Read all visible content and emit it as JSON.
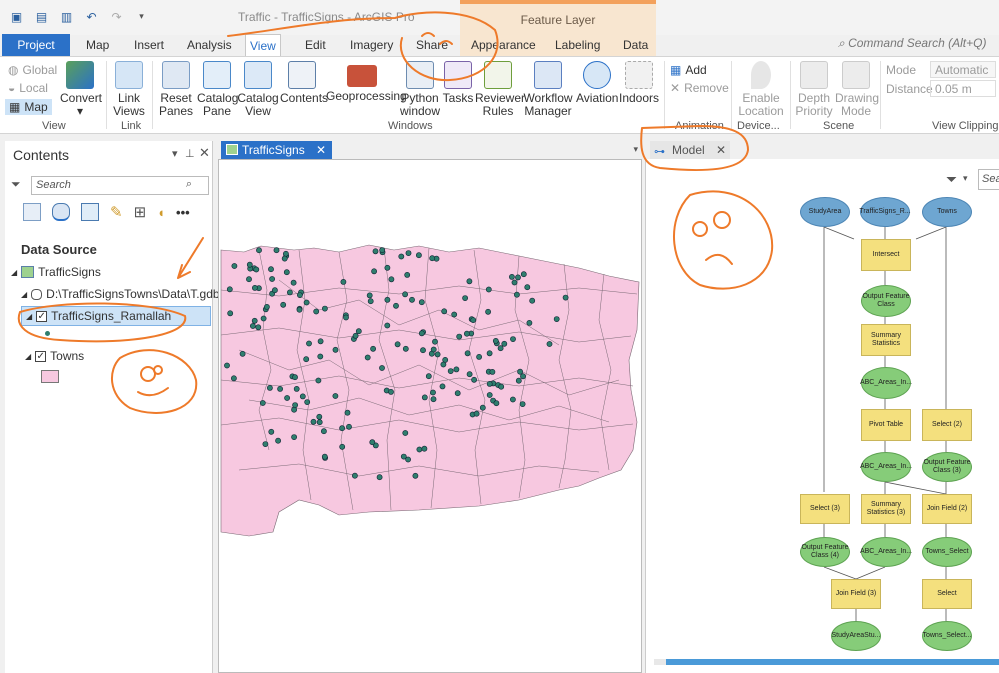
{
  "app": {
    "title": "Traffic - TrafficSigns - ArcGIS Pro",
    "context_tab_header": "Feature Layer"
  },
  "ribbon_tabs": [
    "Project",
    "Map",
    "Insert",
    "Analysis",
    "View",
    "Edit",
    "Imagery",
    "Share",
    "Appearance",
    "Labeling",
    "Data"
  ],
  "active_tab": "View",
  "command_search": "Command Search (Alt+Q)",
  "ribbon": {
    "view_group": {
      "global": "Global",
      "local": "Local",
      "map": "Map",
      "convert": "Convert",
      "label": "View"
    },
    "link_group": {
      "link_views": "Link Views",
      "label": "Link"
    },
    "windows_group": {
      "reset_panes": "Reset Panes",
      "catalog_pane": "Catalog Pane",
      "catalog_view": "Catalog View",
      "contents": "Contents",
      "geoprocessing": "Geoprocessing",
      "python_window": "Python window",
      "tasks": "Tasks",
      "reviewer_rules": "Reviewer Rules",
      "workflow_manager": "Workflow Manager",
      "aviation": "Aviation",
      "indoors": "Indoors",
      "label": "Windows"
    },
    "animation_group": {
      "add": "Add",
      "remove": "Remove",
      "label": "Animation"
    },
    "device_group": {
      "enable_location": "Enable Location",
      "label": "Device..."
    },
    "scene_group": {
      "depth_priority": "Depth Priority",
      "drawing_mode": "Drawing Mode",
      "label": "Scene"
    },
    "clipping_group": {
      "mode_label": "Mode",
      "mode_value": "Automatic",
      "distance_label": "Distance",
      "distance_value": "0.05  m",
      "label": "View Clipping"
    }
  },
  "contents": {
    "title": "Contents",
    "search_placeholder": "Search",
    "section": "Data Source",
    "map_name": "TrafficSigns",
    "gdb_path": "D:\\TrafficSignsTowns\\Data\\T.gdb",
    "layers": [
      {
        "name": "TrafficSigns_Ramallah",
        "checked": true,
        "selected": true
      },
      {
        "name": "Towns",
        "checked": true,
        "selected": false
      }
    ]
  },
  "map_view": {
    "tab": "TrafficSigns"
  },
  "model_view": {
    "tab": "Model",
    "search_placeholder": "Sea",
    "nodes": [
      {
        "id": "studyarea",
        "label": "StudyArea",
        "kind": "data"
      },
      {
        "id": "trafficsigns",
        "label": "TrafficSigns_R...",
        "kind": "data"
      },
      {
        "id": "towns",
        "label": "Towns",
        "kind": "data"
      },
      {
        "id": "intersect",
        "label": "Intersect",
        "kind": "tool"
      },
      {
        "id": "ofc",
        "label": "Output Feature Class",
        "kind": "output"
      },
      {
        "id": "sumstats",
        "label": "Summary Statistics",
        "kind": "tool"
      },
      {
        "id": "abc1",
        "label": "ABC_Areas_In...",
        "kind": "output"
      },
      {
        "id": "pivot",
        "label": "Pivot Table",
        "kind": "tool"
      },
      {
        "id": "select2",
        "label": "Select (2)",
        "kind": "tool"
      },
      {
        "id": "abc2",
        "label": "ABC_Areas_In...",
        "kind": "output"
      },
      {
        "id": "ofc3",
        "label": "Output Feature Class (3)",
        "kind": "output"
      },
      {
        "id": "select3",
        "label": "Select (3)",
        "kind": "tool"
      },
      {
        "id": "sumstats3",
        "label": "Summary Statistics (3)",
        "kind": "tool"
      },
      {
        "id": "joinfield2",
        "label": "Join Field (2)",
        "kind": "tool"
      },
      {
        "id": "ofc4",
        "label": "Output Feature Class (4)",
        "kind": "output"
      },
      {
        "id": "abc3",
        "label": "ABC_Areas_In...",
        "kind": "output"
      },
      {
        "id": "towns_select",
        "label": "Towns_Select",
        "kind": "output"
      },
      {
        "id": "joinfield3",
        "label": "Join Field (3)",
        "kind": "tool"
      },
      {
        "id": "select",
        "label": "Select",
        "kind": "tool"
      },
      {
        "id": "studyareastu",
        "label": "StudyAreaStu...",
        "kind": "output"
      },
      {
        "id": "towns_select2",
        "label": "Towns_Select...",
        "kind": "output"
      }
    ]
  },
  "colors": {
    "accent": "#2b71c8",
    "polygon_fill": "#f7c8e0",
    "point_fill": "#2f7e6e",
    "annotation": "#ee7a2a"
  }
}
